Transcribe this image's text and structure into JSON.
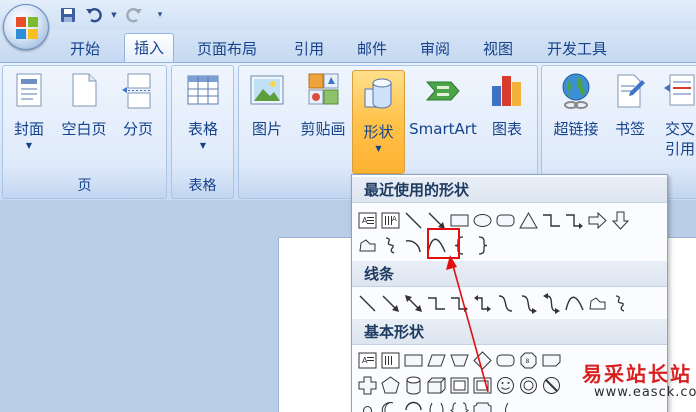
{
  "quick_access": {
    "save_icon": "save-icon",
    "undo_icon": "undo-icon",
    "redo_icon": "redo-icon",
    "customize_icon": "customize-arrow-icon"
  },
  "tabs": [
    {
      "label": "开始"
    },
    {
      "label": "插入",
      "active": true
    },
    {
      "label": "页面布局"
    },
    {
      "label": "引用"
    },
    {
      "label": "邮件"
    },
    {
      "label": "审阅"
    },
    {
      "label": "视图"
    },
    {
      "label": "开发工具"
    }
  ],
  "ribbon": {
    "pages_group": {
      "label": "页",
      "cover": "封面",
      "blank_page": "空白页",
      "page_break": "分页"
    },
    "tables_group": {
      "label": "表格",
      "table": "表格"
    },
    "illustrations_group": {
      "picture": "图片",
      "clipart": "剪贴画",
      "shapes": "形状",
      "smartart": "SmartArt",
      "chart": "图表"
    },
    "links_group": {
      "hyperlink": "超链接",
      "bookmark": "书签",
      "cross_ref_line1": "交叉",
      "cross_ref_line2": "引用"
    }
  },
  "shapes_menu": {
    "recent_title": "最近使用的形状",
    "lines_title": "线条",
    "basic_title": "基本形状"
  },
  "watermark": {
    "title": "易采站长站",
    "url": "www.easck.com"
  },
  "colors": {
    "accent": "#15428b",
    "highlight": "#e01010",
    "active_button": "#ffc24a"
  }
}
